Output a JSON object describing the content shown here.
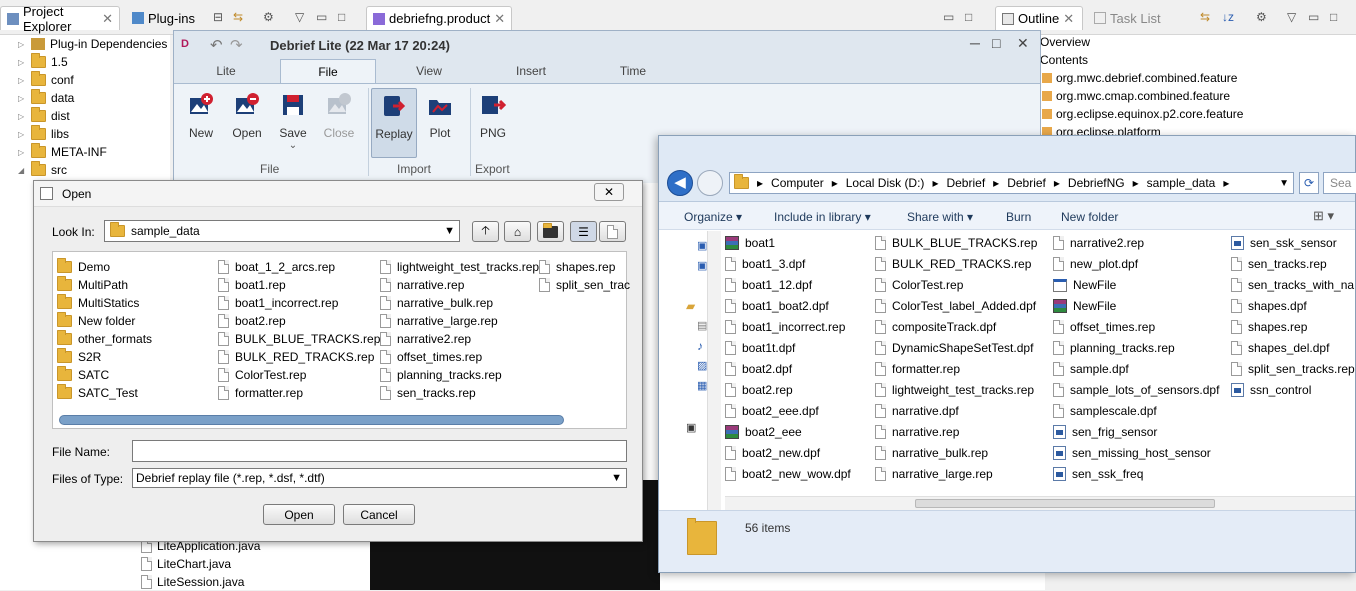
{
  "eclipse": {
    "tabs": {
      "project_explorer": "Project Explorer",
      "plugins": "Plug-ins",
      "editor": "debriefng.product",
      "outline": "Outline",
      "task_list": "Task List"
    },
    "tree": [
      "Plug-in Dependencies",
      "1.5",
      "conf",
      "data",
      "dist",
      "libs",
      "META-INF",
      "src"
    ],
    "java_files": [
      "LiteApplication.java",
      "LiteChart.java",
      "LiteSession.java"
    ],
    "outline_items": [
      "Overview",
      "Contents",
      "org.mwc.debrief.combined.feature",
      "org.mwc.cmap.combined.feature",
      "org.eclipse.equinox.p2.core.feature",
      "org.eclipse.platform"
    ]
  },
  "debrief": {
    "title": "Debrief Lite (22 Mar 17 20:24)",
    "tabs": [
      "Lite",
      "File",
      "View",
      "Insert",
      "Time"
    ],
    "buttons": {
      "new": "New",
      "open": "Open",
      "save": "Save",
      "close": "Close",
      "replay": "Replay",
      "plot": "Plot",
      "png": "PNG"
    },
    "groups": {
      "file": "File",
      "import": "Import",
      "export": "Export"
    }
  },
  "open_dialog": {
    "title": "Open",
    "look_in_label": "Look In:",
    "look_in_value": "sample_data",
    "folders": [
      "Demo",
      "MultiPath",
      "MultiStatics",
      "New folder",
      "other_formats",
      "S2R",
      "SATC",
      "SATC_Test"
    ],
    "col2": [
      "boat_1_2_arcs.rep",
      "boat1.rep",
      "boat1_incorrect.rep",
      "boat2.rep",
      "BULK_BLUE_TRACKS.rep",
      "BULK_RED_TRACKS.rep",
      "ColorTest.rep",
      "formatter.rep"
    ],
    "col3": [
      "lightweight_test_tracks.rep",
      "narrative.rep",
      "narrative_bulk.rep",
      "narrative_large.rep",
      "narrative2.rep",
      "offset_times.rep",
      "planning_tracks.rep",
      "sen_tracks.rep"
    ],
    "col4": [
      "shapes.rep",
      "split_sen_trac"
    ],
    "file_name_label": "File Name:",
    "file_name_value": "",
    "files_of_type_label": "Files of Type:",
    "files_of_type_value": "Debrief replay file (*.rep, *.dsf, *.dtf)",
    "open_button": "Open",
    "cancel_button": "Cancel"
  },
  "explorer": {
    "breadcrumb": [
      "Computer",
      "Local Disk (D:)",
      "Debrief",
      "Debrief",
      "DebriefNG",
      "sample_data"
    ],
    "search_placeholder": "Sea",
    "toolbar": {
      "organize": "Organize",
      "include": "Include in library",
      "share": "Share with",
      "burn": "Burn",
      "new_folder": "New folder"
    },
    "columns": [
      [
        {
          "n": "boat1",
          "t": "rar"
        },
        {
          "n": "boat1_3.dpf",
          "t": "doc"
        },
        {
          "n": "boat1_12.dpf",
          "t": "doc"
        },
        {
          "n": "boat1_boat2.dpf",
          "t": "doc"
        },
        {
          "n": "boat1_incorrect.rep",
          "t": "doc"
        },
        {
          "n": "boat1t.dpf",
          "t": "doc"
        },
        {
          "n": "boat2.dpf",
          "t": "doc"
        },
        {
          "n": "boat2.rep",
          "t": "doc"
        },
        {
          "n": "boat2_eee.dpf",
          "t": "doc"
        },
        {
          "n": "boat2_eee",
          "t": "rar"
        },
        {
          "n": "boat2_new.dpf",
          "t": "doc"
        },
        {
          "n": "boat2_new_wow.dpf",
          "t": "doc"
        }
      ],
      [
        {
          "n": "BULK_BLUE_TRACKS.rep",
          "t": "doc"
        },
        {
          "n": "BULK_RED_TRACKS.rep",
          "t": "doc"
        },
        {
          "n": "ColorTest.rep",
          "t": "doc"
        },
        {
          "n": "ColorTest_label_Added.dpf",
          "t": "doc"
        },
        {
          "n": "compositeTrack.dpf",
          "t": "doc"
        },
        {
          "n": "DynamicShapeSetTest.dpf",
          "t": "doc"
        },
        {
          "n": "formatter.rep",
          "t": "doc"
        },
        {
          "n": "lightweight_test_tracks.rep",
          "t": "doc"
        },
        {
          "n": "narrative.dpf",
          "t": "doc"
        },
        {
          "n": "narrative.rep",
          "t": "doc"
        },
        {
          "n": "narrative_bulk.rep",
          "t": "doc"
        },
        {
          "n": "narrative_large.rep",
          "t": "doc"
        }
      ],
      [
        {
          "n": "narrative2.rep",
          "t": "doc"
        },
        {
          "n": "new_plot.dpf",
          "t": "doc"
        },
        {
          "n": "NewFile",
          "t": "app"
        },
        {
          "n": "NewFile",
          "t": "rar"
        },
        {
          "n": "offset_times.rep",
          "t": "doc"
        },
        {
          "n": "planning_tracks.rep",
          "t": "doc"
        },
        {
          "n": "sample.dpf",
          "t": "doc"
        },
        {
          "n": "sample_lots_of_sensors.dpf",
          "t": "doc"
        },
        {
          "n": "samplescale.dpf",
          "t": "doc"
        },
        {
          "n": "sen_frig_sensor",
          "t": "cfg"
        },
        {
          "n": "sen_missing_host_sensor",
          "t": "cfg"
        },
        {
          "n": "sen_ssk_freq",
          "t": "cfg"
        }
      ],
      [
        {
          "n": "sen_ssk_sensor",
          "t": "cfg"
        },
        {
          "n": "sen_tracks.rep",
          "t": "doc"
        },
        {
          "n": "sen_tracks_with_na",
          "t": "doc"
        },
        {
          "n": "shapes.dpf",
          "t": "doc"
        },
        {
          "n": "shapes.rep",
          "t": "doc"
        },
        {
          "n": "shapes_del.dpf",
          "t": "doc"
        },
        {
          "n": "split_sen_tracks.rep",
          "t": "doc"
        },
        {
          "n": "ssn_control",
          "t": "cfg"
        }
      ]
    ],
    "item_count": "56 items"
  }
}
